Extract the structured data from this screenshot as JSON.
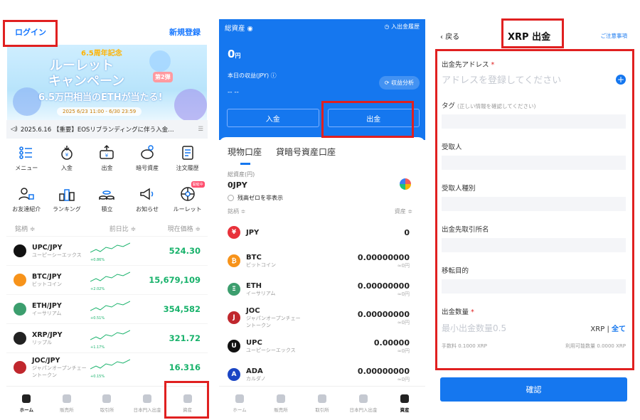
{
  "p1": {
    "login": "ログイン",
    "signup": "新規登録",
    "banner": {
      "anniv": "6.5周年記念",
      "title1": "ルーレット",
      "title2": "キャンペーン",
      "badge": "第2弾",
      "eth": "6.5万円相当のETHが当たる!",
      "date": "2025 6/23 11:00 - 6/30 23:59"
    },
    "news": "2025.6.16 【重要】EOSリブランディングに伴う入金…",
    "icons": [
      "メニュー",
      "入金",
      "出金",
      "暗号資産",
      "注文履歴",
      "お友達紹介",
      "ランキング",
      "積立",
      "お知らせ",
      "ルーレット"
    ],
    "icon_badge": "開催中",
    "cols": [
      "銘柄 ≑",
      "前日比 ≑",
      "現在価格 ≑"
    ],
    "rows": [
      {
        "sym": "UPC/JPY",
        "name": "ユーピーシーエックス",
        "chg": "+0.86%",
        "price": "524.30",
        "color": "#111"
      },
      {
        "sym": "BTC/JPY",
        "name": "ビットコイン",
        "chg": "+2.02%",
        "price": "15,679,109",
        "color": "#f7931a"
      },
      {
        "sym": "ETH/JPY",
        "name": "イーサリアム",
        "chg": "+0.51%",
        "price": "354,582",
        "color": "#3c9e6e"
      },
      {
        "sym": "XRP/JPY",
        "name": "リップル",
        "chg": "+1.17%",
        "price": "321.72",
        "color": "#222"
      },
      {
        "sym": "JOC/JPY",
        "name": "ジャパンオープンチェーントークン",
        "chg": "+0.15%",
        "price": "16.316",
        "color": "#c0272d"
      }
    ],
    "tabs": [
      "ホーム",
      "販売所",
      "取引所",
      "日本円入出金",
      "資産"
    ]
  },
  "p2": {
    "total_label": "総資産",
    "history": "入出金履歴",
    "balance": "0",
    "unit": "円",
    "today": "本日の収益(JPY) ⓘ",
    "dash": "-- --",
    "analysis": "収益分析",
    "deposit": "入金",
    "withdraw": "出金",
    "tab1": "現物口座",
    "tab2": "貸暗号資産口座",
    "total_jpy_label": "総資産(円)",
    "total_jpy": "0JPY",
    "hide_zero": "残高ゼロを非表示",
    "col1": "銘柄 ≑",
    "col2": "資産 ≑",
    "assets": [
      {
        "sym": "JPY",
        "name": "",
        "amt": "0",
        "sub": "",
        "color": "#e8313a",
        "glyph": "¥"
      },
      {
        "sym": "BTC",
        "name": "ビットコイン",
        "amt": "0.00000000",
        "sub": "≈0円",
        "color": "#f7931a",
        "glyph": "₿"
      },
      {
        "sym": "ETH",
        "name": "イーサリアム",
        "amt": "0.00000000",
        "sub": "≈0円",
        "color": "#3c9e6e",
        "glyph": "Ξ"
      },
      {
        "sym": "JOC",
        "name": "ジャパンオープンチェーントークン",
        "amt": "0.00000000",
        "sub": "≈0円",
        "color": "#c0272d",
        "glyph": "J"
      },
      {
        "sym": "UPC",
        "name": "ユーピーシーエックス",
        "amt": "0.00000",
        "sub": "≈0円",
        "color": "#111",
        "glyph": "U"
      },
      {
        "sym": "ADA",
        "name": "カルダノ",
        "amt": "0.00000000",
        "sub": "≈0円",
        "color": "#1a45c4",
        "glyph": "A"
      }
    ],
    "tabs": [
      "ホーム",
      "販売所",
      "取引所",
      "日本円入出金",
      "資産"
    ]
  },
  "p3": {
    "back": "戻る",
    "title": "XRP 出金",
    "note": "ご注意事項",
    "addr_label": "出金先アドレス",
    "addr_ph": "アドレスを登録してください",
    "tag_label": "タグ",
    "tag_hint": "(正しい情報を確認してください)",
    "recipient": "受取人",
    "recipient_type": "受取人種別",
    "exchange": "出金先取引所名",
    "purpose": "移転目的",
    "qty_label": "出金数量",
    "qty_ph": "最小出金数量0.5",
    "asset": "XRP",
    "all": "全て",
    "fee": "手数料 0.1000 XRP",
    "available": "利用可能数量 0.0000 XRP",
    "confirm": "確認"
  }
}
